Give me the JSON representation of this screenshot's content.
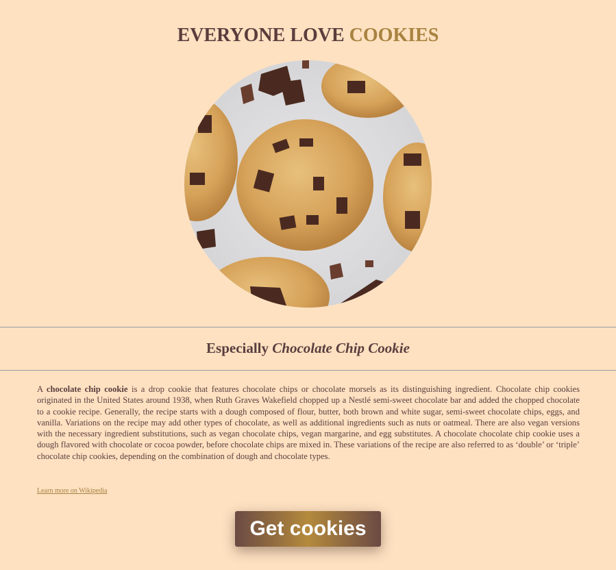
{
  "header": {
    "title_part1": "EVERYONE LOVE ",
    "title_part2": "COOKIES"
  },
  "hero_image": {
    "alt": "chocolate chip cookies"
  },
  "section": {
    "subtitle_prefix": "Especially ",
    "subtitle_emphasis": "Chocolate Chip Cookie"
  },
  "description": {
    "lead": "A ",
    "bold_term": "chocolate chip cookie",
    "body": " is a drop cookie that features chocolate chips or chocolate morsels as its distinguishing ingredient. Chocolate chip cookies originated in the United States around 1938, when Ruth Graves Wakefield chopped up a Nestlé semi-sweet chocolate bar and added the chopped chocolate to a cookie recipe. Generally, the recipe starts with a dough composed of flour, butter, both brown and white sugar, semi-sweet chocolate chips, eggs, and vanilla. Variations on the recipe may add other types of chocolate, as well as additional ingredients such as nuts or oatmeal. There are also vegan versions with the necessary ingredient substitutions, such as vegan chocolate chips, vegan margarine, and egg substitutes. A chocolate chocolate chip cookie uses a dough flavored with chocolate or cocoa powder, before chocolate chips are mixed in. These variations of the recipe are also referred to as ‘double’ or ‘triple’ chocolate chip cookies, depending on the combination of dough and chocolate types."
  },
  "links": {
    "wikipedia": "Learn more on Wikipedia"
  },
  "cta": {
    "label": "Get cookies"
  },
  "colors": {
    "background": "#fde1c1",
    "text": "#5a3e3e",
    "accent": "#a8823f"
  }
}
